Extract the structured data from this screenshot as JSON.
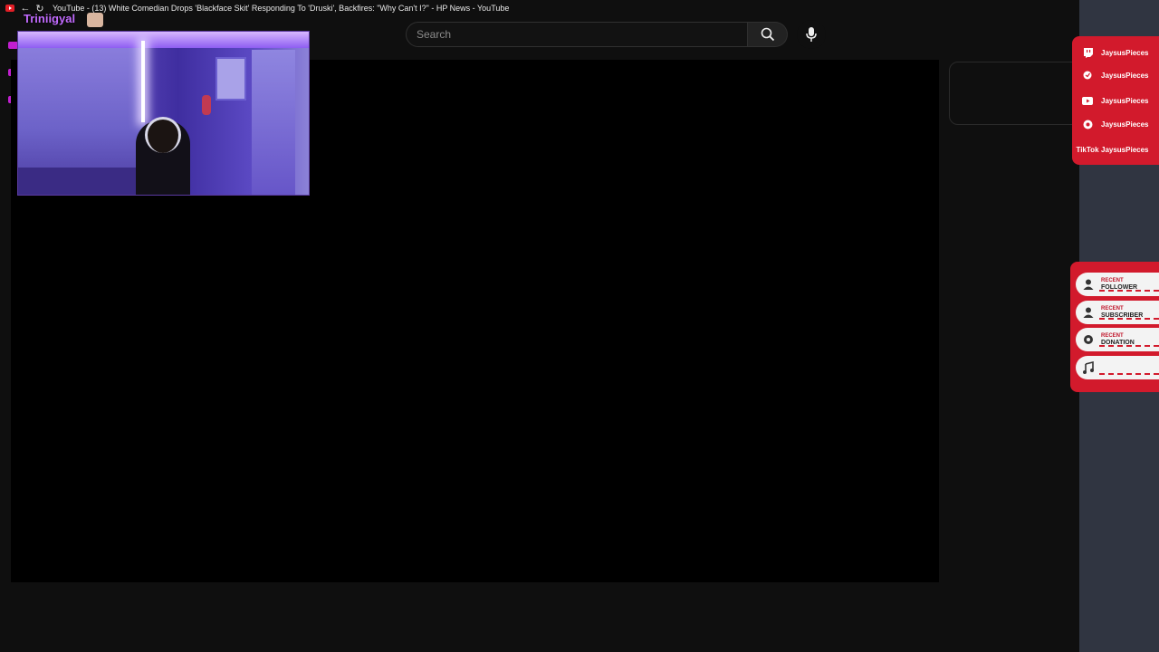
{
  "window": {
    "title": "YouTube - (13) White Comedian Drops 'Blackface Skit' Responding To 'Druski', Backfires: \"Why Can't I?\" - HP News - YouTube"
  },
  "search": {
    "placeholder": "Search"
  },
  "overlay": {
    "streamer_name": "Triniigyal"
  },
  "socials": [
    {
      "icon": "twitch-icon",
      "label": "",
      "handle": "JaysusPieces"
    },
    {
      "icon": "twitter-icon",
      "label": "",
      "handle": "JaysusPieces"
    },
    {
      "icon": "youtube-icon",
      "label": "",
      "handle": "JaysusPieces"
    },
    {
      "icon": "instagram-icon",
      "label": "",
      "handle": "JaysusPieces"
    },
    {
      "icon": "tiktok-icon",
      "label": "TikTok",
      "handle": "JaysusPieces"
    }
  ],
  "recent": [
    {
      "icon": "user-icon",
      "title": "RECENT",
      "label": "FOLLOWER"
    },
    {
      "icon": "user-icon",
      "title": "RECENT",
      "label": "SUBSCRIBER"
    },
    {
      "icon": "gear-icon",
      "title": "RECENT",
      "label": "DONATION"
    },
    {
      "icon": "music-icon",
      "title": "",
      "label": ""
    }
  ],
  "colors": {
    "widget_red": "#d21a2c",
    "streamer_purple": "#c26bff"
  }
}
